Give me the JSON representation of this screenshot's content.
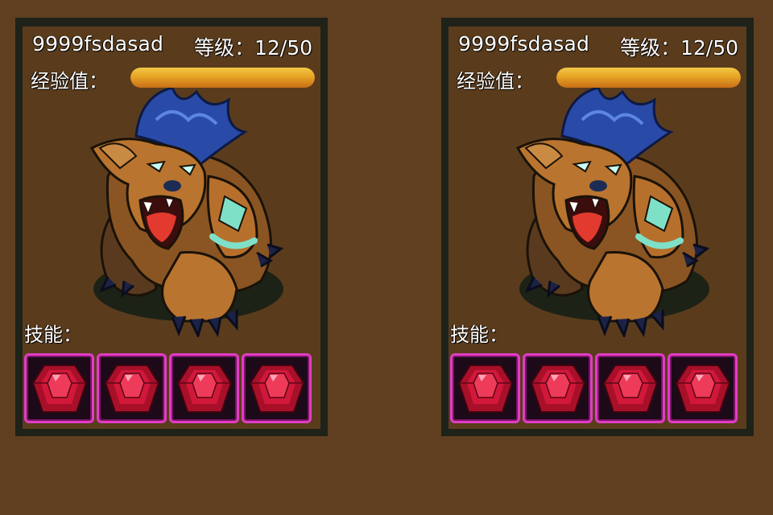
{
  "cards": [
    {
      "name": "9999fsdasad",
      "level_text": "等级：12/50",
      "exp_label": "经验值：",
      "exp_fraction": 1.0,
      "monster_icon": "werewolf-beast-icon",
      "skill_label": "技能：",
      "skills": [
        "ruby-gem-icon",
        "ruby-gem-icon",
        "ruby-gem-icon",
        "ruby-gem-icon"
      ]
    },
    {
      "name": "9999fsdasad",
      "level_text": "等级：12/50",
      "exp_label": "经验值：",
      "exp_fraction": 1.0,
      "monster_icon": "werewolf-beast-icon",
      "skill_label": "技能：",
      "skills": [
        "ruby-gem-icon",
        "ruby-gem-icon",
        "ruby-gem-icon",
        "ruby-gem-icon"
      ]
    }
  ],
  "colors": {
    "background": "#5f3f20",
    "card_border": "#1e2219",
    "exp_bar": "#e7a425",
    "skill_border": "#e13dc4",
    "gem": "#d2183a"
  }
}
